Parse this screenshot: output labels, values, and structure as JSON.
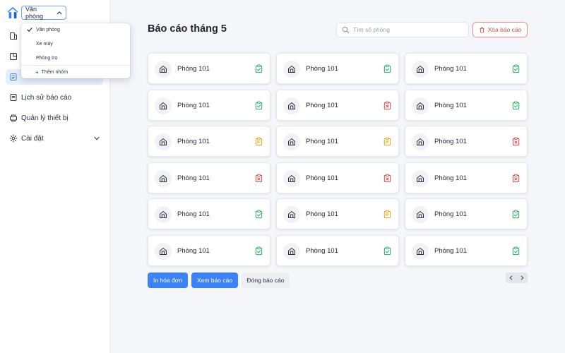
{
  "sidebar": {
    "group_selector": {
      "value": "Văn phòng",
      "open": true
    },
    "dropdown": {
      "options": [
        {
          "label": "Văn phòng",
          "selected": true
        },
        {
          "label": "Xe máy",
          "selected": false
        },
        {
          "label": "Phòng trọ",
          "selected": false
        }
      ],
      "add_label": "Thêm nhóm"
    },
    "nav": [
      {
        "label": "",
        "icon": "building-icon"
      },
      {
        "label": "",
        "icon": "room-list-icon"
      },
      {
        "label": "",
        "icon": "report-icon",
        "active": true
      },
      {
        "label": "Lịch sử báo cáo",
        "icon": "history-icon"
      },
      {
        "label": "Quản lý thiết bị",
        "icon": "device-icon"
      },
      {
        "label": "Cài đặt",
        "icon": "gear-icon",
        "has_submenu": true
      }
    ]
  },
  "header": {
    "title": "Báo cáo tháng 5",
    "search_placeholder": "Tìm số phòng",
    "delete_label": "Xóa báo cáo"
  },
  "rooms": [
    {
      "name": "Phòng 101",
      "status": "ok"
    },
    {
      "name": "Phòng 101",
      "status": "ok"
    },
    {
      "name": "Phòng 101",
      "status": "ok"
    },
    {
      "name": "Phòng 101",
      "status": "ok"
    },
    {
      "name": "Phòng 101",
      "status": "error"
    },
    {
      "name": "Phòng 101",
      "status": "ok"
    },
    {
      "name": "Phòng 101",
      "status": "pending"
    },
    {
      "name": "Phòng 101",
      "status": "pending"
    },
    {
      "name": "Phòng 101",
      "status": "error"
    },
    {
      "name": "Phòng 101",
      "status": "error"
    },
    {
      "name": "Phòng 101",
      "status": "error"
    },
    {
      "name": "Phòng 101",
      "status": "error"
    },
    {
      "name": "Phòng 101",
      "status": "ok"
    },
    {
      "name": "Phòng 101",
      "status": "pending"
    },
    {
      "name": "Phòng 101",
      "status": "ok"
    },
    {
      "name": "Phòng 101",
      "status": "ok"
    },
    {
      "name": "Phòng 101",
      "status": "ok"
    },
    {
      "name": "Phòng 101",
      "status": "ok"
    }
  ],
  "actions": {
    "print_label": "In hóa đơn",
    "view_label": "Xem báo cáo",
    "close_label": "Đóng báo cáo"
  },
  "colors": {
    "accent": "#3b82f6",
    "ok": "#22b35e",
    "pending": "#e8a317",
    "error": "#e04848"
  }
}
